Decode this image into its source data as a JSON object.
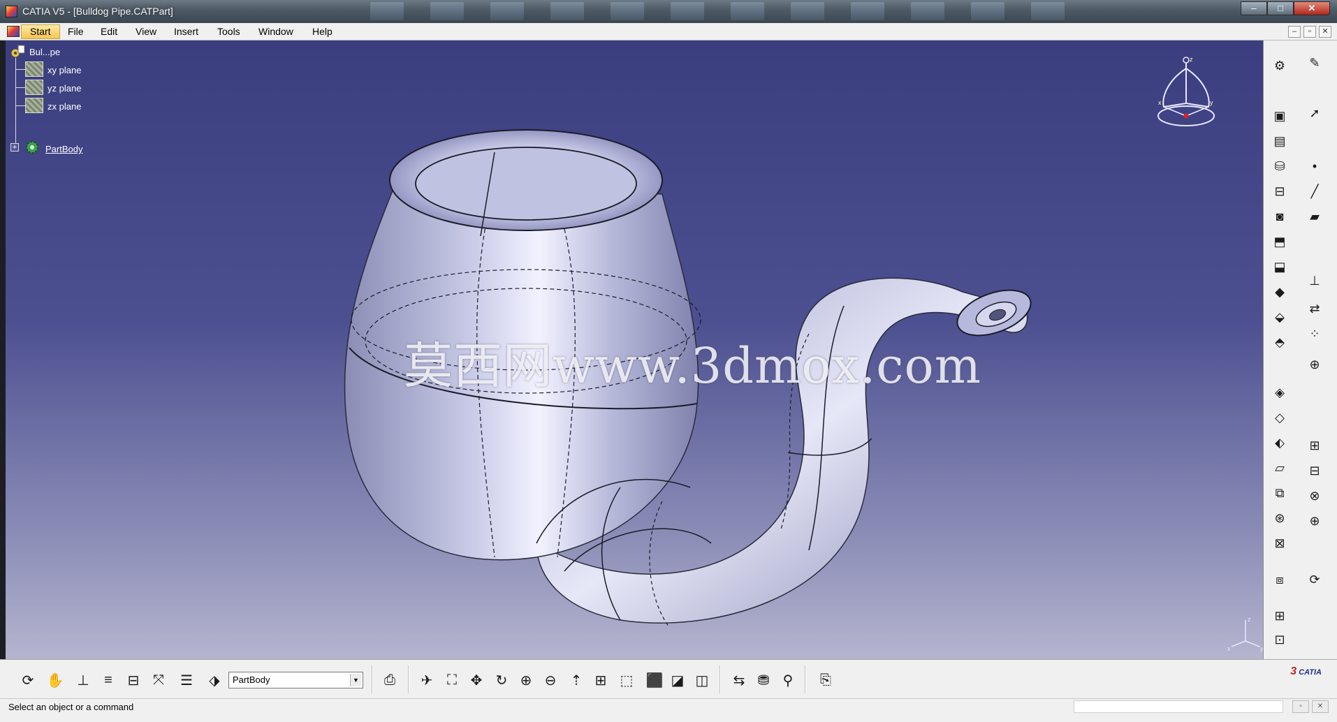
{
  "window": {
    "title": "CATIA V5 - [Bulldog Pipe.CATPart]",
    "minimize_glyph": "–",
    "maximize_glyph": "□",
    "close_glyph": "✕"
  },
  "menu": {
    "items": [
      "Start",
      "File",
      "Edit",
      "View",
      "Insert",
      "Tools",
      "Window",
      "Help"
    ],
    "doc_minimize": "–",
    "doc_restore": "▫",
    "doc_close": "✕"
  },
  "spec_tree": {
    "root": "Bul...pe",
    "planes": [
      "xy plane",
      "yz plane",
      "zx plane"
    ],
    "body": "PartBody",
    "expander": "+"
  },
  "compass_labels": {
    "z": "z",
    "x": "x",
    "y": "y"
  },
  "triad_labels": {
    "z": "z",
    "x": "x",
    "y": "y"
  },
  "watermark": "莫西网www.3dmox.com",
  "bottom_toolbar": {
    "body_selector_value": "PartBody",
    "body_selector_arrow": "▼"
  },
  "logo": {
    "mark": "3",
    "text": "CATIA"
  },
  "status": {
    "message": "Select an object or a command"
  },
  "colors": {
    "viewport_top": "#3a3e7f",
    "viewport_bottom": "#b5b5cf",
    "part_surface": "#b9badb",
    "menu_start_highlight": "#f5c552"
  },
  "icons": {
    "right_col1": [
      "compass-icon",
      "sketcher-icon",
      "reference-icon",
      "hole-icon",
      "pocket-icon",
      "shaft-icon",
      "pad-icon",
      "rib-icon",
      "slot-icon",
      "stiffener-icon",
      "loft-icon",
      "fillet-icon",
      "chamfer-icon",
      "draft-icon",
      "shell-icon",
      "thickness-icon",
      "thread-icon",
      "split-icon",
      "mirror-icon",
      "pattern-icon",
      "scaling-icon",
      "boolean-icon",
      "apply-material-icon",
      "measure-icon"
    ],
    "right_col2": [
      "sketch-icon",
      "select-arrow-icon",
      "point-icon",
      "line-icon",
      "plane-icon",
      "axis-system-icon",
      "translate-icon",
      "pattern-grid-icon",
      "zoom-area-icon",
      "boolean-add-icon",
      "boolean-remove-icon",
      "boolean-intersect-icon",
      "boolean-union-icon",
      "analysis-icon"
    ]
  }
}
